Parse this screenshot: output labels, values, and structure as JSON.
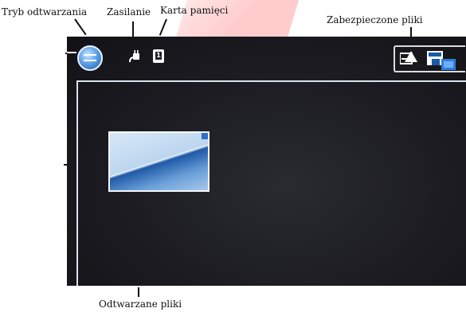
{
  "labels": {
    "playback_mode": "Tryb odtwarzania",
    "power": "Zasilanie",
    "memory_card": "Karta pamięci",
    "protected_files": "Zabezpieczone pliki",
    "playback_files": "Odtwarzane pliki"
  },
  "screen": {
    "memory_card_number": "1"
  },
  "icons": {
    "playback_mode": "playback-mode-icon",
    "power": "power-plug-icon",
    "memory_card": "memory-card-icon",
    "protected_files": "protected-files-icon"
  },
  "colors": {
    "screen_background": "#1b1b21",
    "accent_blue": "#2f6fc8",
    "frame_line": "#d8e3ea"
  }
}
